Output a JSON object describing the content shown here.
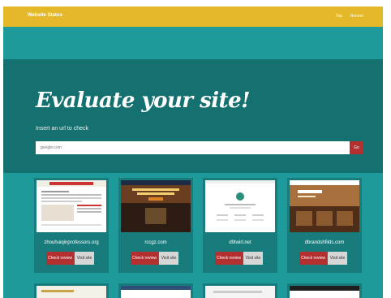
{
  "navbar": {
    "brand": "Website Status",
    "links": [
      "Top",
      "Recent"
    ]
  },
  "hero": {
    "title": "Evaluate your site!",
    "subtitle": "Insert an url to check",
    "search_placeholder": "google.com",
    "go_label": "Go"
  },
  "cards": [
    {
      "site": "zhouhuiqinprofessors.org",
      "check_label": "Check review",
      "visit_label": "Visit site",
      "thumb_icon": "website-screenshot"
    },
    {
      "site": "rccgz.com",
      "check_label": "Check review",
      "visit_label": "Visit site",
      "thumb_icon": "website-screenshot"
    },
    {
      "site": "d9twirl.net",
      "check_label": "Check review",
      "visit_label": "Visit site",
      "thumb_icon": "website-screenshot"
    },
    {
      "site": "dbrandshfilds.com",
      "check_label": "Check review",
      "visit_label": "Visit site",
      "thumb_icon": "website-screenshot"
    }
  ],
  "colors": {
    "topbar": "#e5b829",
    "background": "#1f9a9a",
    "hero": "#157070",
    "card": "#187c7c",
    "accent_red": "#b43030",
    "button_grey": "#d6d6d6"
  }
}
